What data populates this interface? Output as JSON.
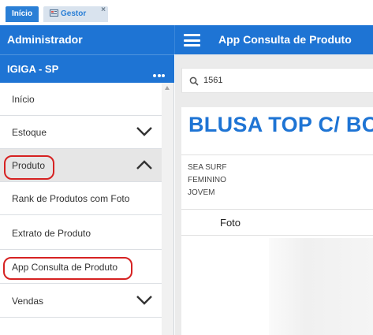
{
  "tabs": [
    {
      "label": "Início",
      "active": true
    },
    {
      "label": "Gestor",
      "active": false,
      "icon": "gestor-icon",
      "close": "×"
    }
  ],
  "header": {
    "admin_label": "Administrador",
    "app_title": "App Consulta de Produto",
    "menu_icon": "hamburger-icon"
  },
  "sidebar": {
    "company": "IGIGA - SP",
    "company_menu_icon": "more-dots-icon",
    "items": [
      {
        "label": "Início"
      },
      {
        "label": "Estoque",
        "chevron": "down"
      },
      {
        "label": "Produto",
        "chevron": "up",
        "selected": true
      },
      {
        "label": "Rank de Produtos com Foto"
      },
      {
        "label": "Extrato de Produto"
      },
      {
        "label": "App Consulta de Produto"
      },
      {
        "label": "Vendas",
        "chevron": "down"
      }
    ]
  },
  "search": {
    "value": "1561",
    "icon": "search-icon"
  },
  "product": {
    "title": "BLUSA TOP C/ BO",
    "brand": "SEA SURF",
    "gender": "FEMININO",
    "line": "JOVEM",
    "photo_column": "Foto"
  },
  "colors": {
    "accent": "#1e74d4",
    "highlight_circle": "#d62222",
    "selected_row": "#e6e6e6"
  }
}
